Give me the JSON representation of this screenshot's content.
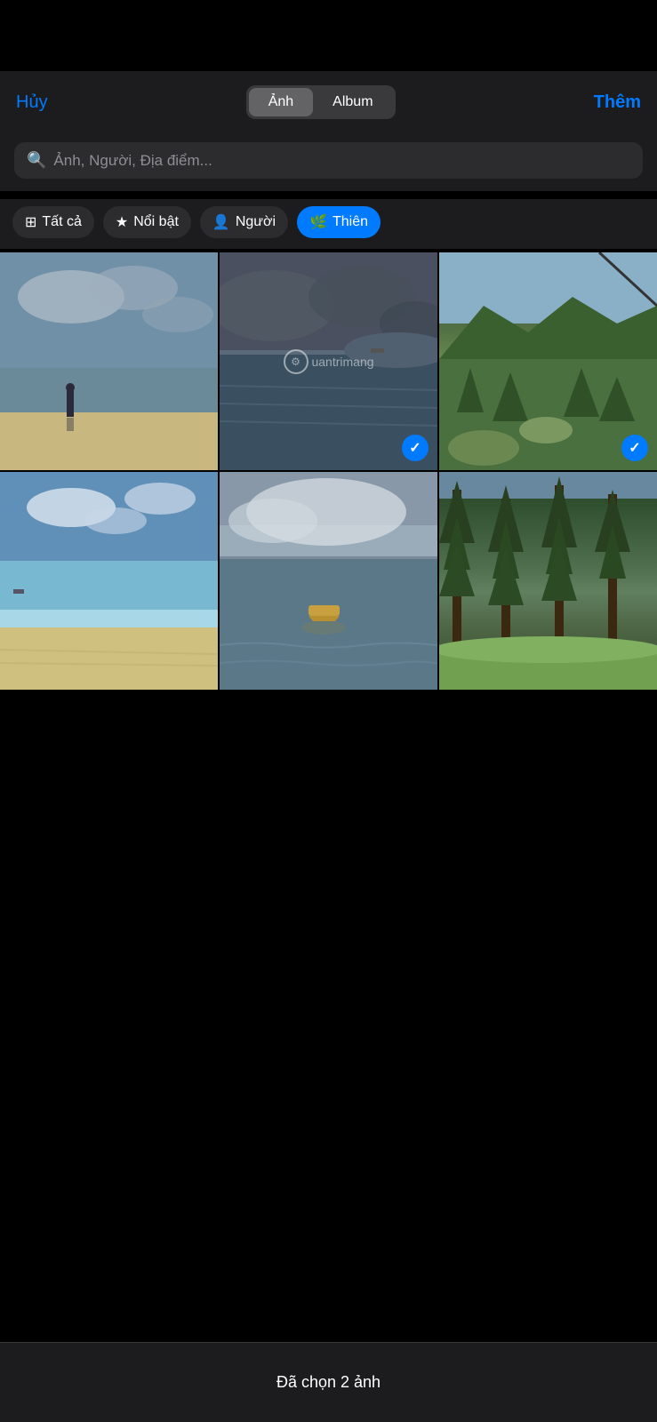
{
  "topBar": {
    "background": "#000"
  },
  "navBar": {
    "cancel_label": "Hủy",
    "segment_photo": "Ảnh",
    "segment_album": "Album",
    "add_label": "Thêm"
  },
  "searchBar": {
    "placeholder": "Ảnh, Người, Địa điểm..."
  },
  "filterBar": {
    "filters": [
      {
        "id": "all",
        "label": "Tất cả",
        "icon": "grid",
        "active": false
      },
      {
        "id": "featured",
        "label": "Nổi bật",
        "icon": "star",
        "active": false
      },
      {
        "id": "people",
        "label": "Người",
        "icon": "person",
        "active": false
      },
      {
        "id": "nature",
        "label": "Thiên",
        "icon": "leaf",
        "active": true
      }
    ]
  },
  "photos": [
    {
      "id": 1,
      "selected": false,
      "type": "beach-person"
    },
    {
      "id": 2,
      "selected": true,
      "type": "ocean-clouds"
    },
    {
      "id": 3,
      "selected": true,
      "type": "forest-mountains"
    },
    {
      "id": 4,
      "selected": false,
      "type": "beach-clear"
    },
    {
      "id": 5,
      "selected": false,
      "type": "ocean-boat"
    },
    {
      "id": 6,
      "selected": false,
      "type": "pine-forest"
    }
  ],
  "watermark": {
    "text": "uantrimang"
  },
  "bottomBar": {
    "label": "Đã chọn 2 ảnh"
  }
}
